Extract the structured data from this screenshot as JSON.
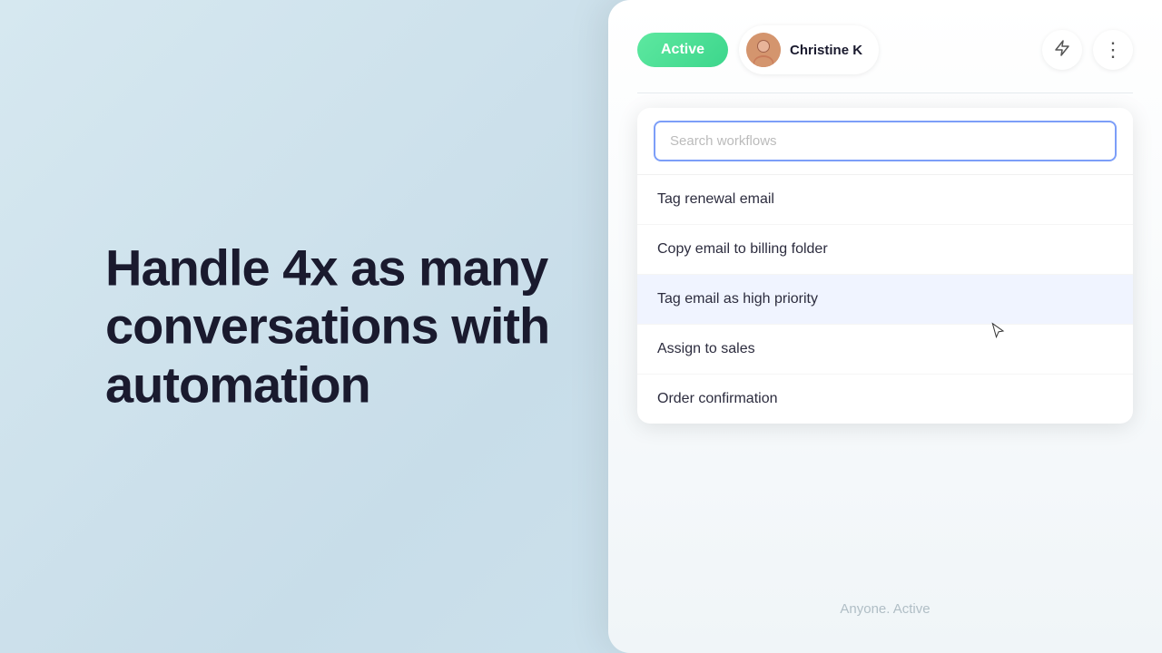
{
  "background": {
    "color": "#cde4ee"
  },
  "hero": {
    "text": "Handle 4x as many conversations with automation"
  },
  "topbar": {
    "active_label": "Active",
    "user_name": "Christine K",
    "lightning_icon": "⚡",
    "more_icon": "⋮"
  },
  "search": {
    "placeholder": "Search workflows"
  },
  "workflows": [
    {
      "label": "Tag renewal email"
    },
    {
      "label": "Copy email to billing folder"
    },
    {
      "label": "Tag email as high priority",
      "highlighted": true
    },
    {
      "label": "Assign to sales"
    },
    {
      "label": "Order confirmation"
    }
  ],
  "bottom_label": "Anyone. Active"
}
